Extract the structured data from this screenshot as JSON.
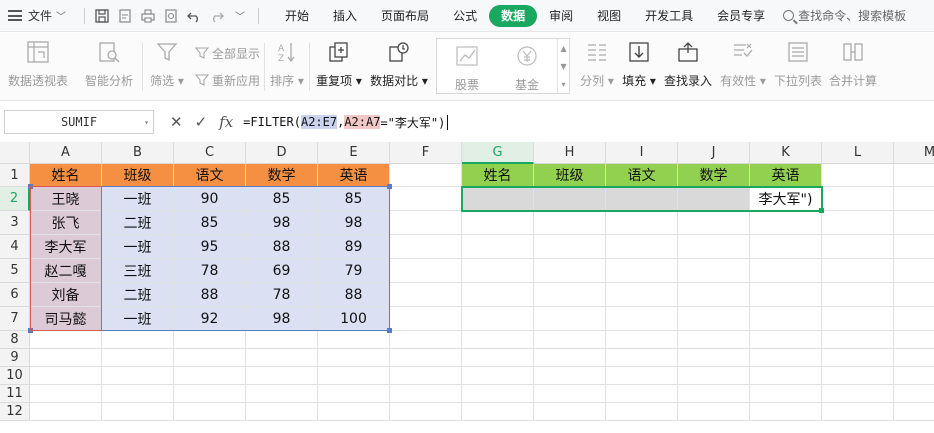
{
  "menubar": {
    "file_label": "文件",
    "tabs": [
      "开始",
      "插入",
      "页面布局",
      "公式",
      "数据",
      "审阅",
      "视图",
      "开发工具",
      "会员专享"
    ],
    "active_tab": "数据",
    "search_label": "查找命令、搜索模板"
  },
  "ribbon": {
    "pivot": "数据透视表",
    "smart": "智能分析",
    "filter": "筛选",
    "show_all": "全部显示",
    "reapply": "重新应用",
    "sort": "排序",
    "duplicates": "重复项",
    "compare": "数据对比",
    "stock": "股票",
    "fund": "基金",
    "split": "分列",
    "fill": "填充",
    "lookup": "查找录入",
    "validity": "有效性",
    "dropdown": "下拉列表",
    "consolidate": "合并计算"
  },
  "formula_bar": {
    "name_box": "SUMIF",
    "formula_prefix": "=FILTER(",
    "ref1": "A2:E7",
    "comma": ",",
    "ref2": "A2:A7",
    "formula_suffix": "=\"李大军\")"
  },
  "sheet": {
    "columns": [
      "A",
      "B",
      "C",
      "D",
      "E",
      "F",
      "G",
      "H",
      "I",
      "J",
      "K",
      "L",
      "M"
    ],
    "rows": [
      "1",
      "2",
      "3",
      "4",
      "5",
      "6",
      "7",
      "8",
      "9",
      "10",
      "11",
      "12"
    ],
    "selected_column": "G",
    "selected_row": "2",
    "source_header": [
      "姓名",
      "班级",
      "语文",
      "数学",
      "英语"
    ],
    "source_rows": [
      [
        "王晓",
        "一班",
        "90",
        "85",
        "85"
      ],
      [
        "张飞",
        "二班",
        "85",
        "98",
        "98"
      ],
      [
        "李大军",
        "一班",
        "95",
        "88",
        "89"
      ],
      [
        "赵二嘎",
        "三班",
        "78",
        "69",
        "79"
      ],
      [
        "刘备",
        "二班",
        "88",
        "78",
        "88"
      ],
      [
        "司马懿",
        "一班",
        "92",
        "98",
        "100"
      ]
    ],
    "output_header": [
      "姓名",
      "班级",
      "语文",
      "数学",
      "英语"
    ],
    "output_overflow_text": "李大军\")"
  },
  "colors": {
    "accent": "#1aa860",
    "header_orange": "#f59042",
    "header_green": "#92d050",
    "name_fill": "#dccbd6",
    "score_fill": "#dbe1f2",
    "output_fill": "#d9d9d9"
  }
}
